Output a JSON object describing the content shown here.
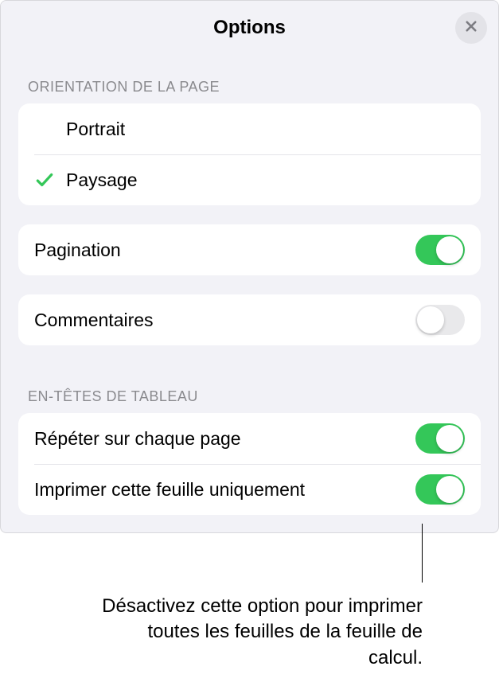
{
  "header": {
    "title": "Options"
  },
  "orientation": {
    "header": "Orientation de la page",
    "options": {
      "portrait": "Portrait",
      "paysage": "Paysage"
    },
    "selected": "paysage"
  },
  "pagination": {
    "label": "Pagination",
    "value": true
  },
  "comments": {
    "label": "Commentaires",
    "value": false
  },
  "tableHeaders": {
    "header": "En-têtes de tableau",
    "repeat": {
      "label": "Répéter sur chaque page",
      "value": true
    },
    "printCurrent": {
      "label": "Imprimer cette feuille uniquement",
      "value": true
    }
  },
  "callout": {
    "text": "Désactivez cette option pour imprimer toutes les feuilles de la feuille de calcul."
  },
  "colors": {
    "accent": "#34c759",
    "panelBg": "#f2f2f7",
    "rowBg": "#ffffff",
    "sectionText": "#8a8a8e"
  }
}
